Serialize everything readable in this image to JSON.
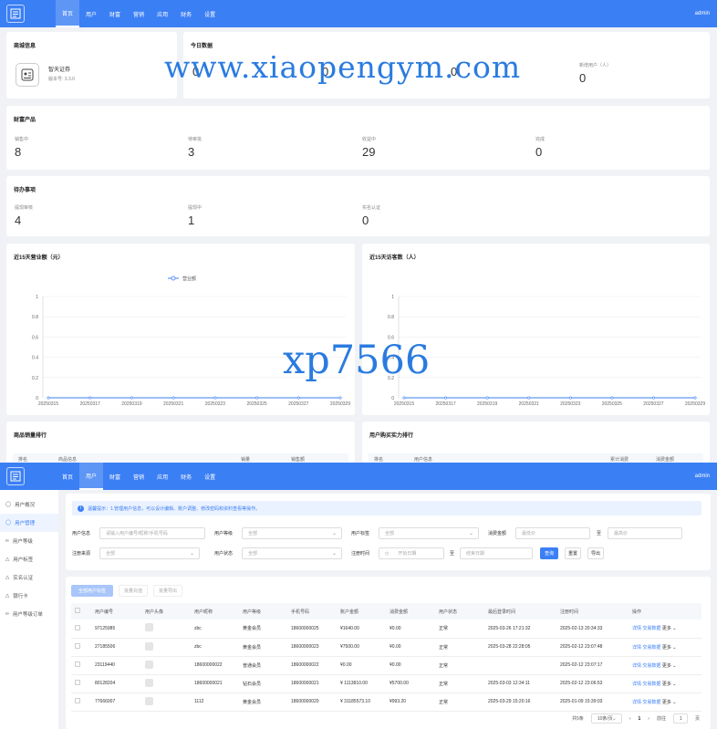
{
  "topnav": {
    "items": [
      "首页",
      "用户",
      "财富",
      "营销",
      "应用",
      "财务",
      "设置"
    ],
    "user": "admin"
  },
  "store_info": {
    "title": "商城信息",
    "name": "智天证券",
    "version": "版本号: 3.3.0"
  },
  "today": {
    "title": "今日数据",
    "stats": [
      {
        "label": "",
        "value": "0"
      },
      {
        "label": "",
        "value": "0"
      },
      {
        "label": "",
        "value": "0"
      },
      {
        "label": "新增用户（人）",
        "value": "0"
      }
    ]
  },
  "wealth": {
    "title": "财富产品",
    "stats": [
      {
        "label": "销售中",
        "value": "8"
      },
      {
        "label": "待审批",
        "value": "3"
      },
      {
        "label": "收益中",
        "value": "29"
      },
      {
        "label": "完成",
        "value": "0"
      }
    ]
  },
  "todo": {
    "title": "待办事项",
    "stats": [
      {
        "label": "提现审核",
        "value": "4"
      },
      {
        "label": "提现中",
        "value": "1"
      },
      {
        "label": "实名认证",
        "value": "0"
      }
    ]
  },
  "chart_data": [
    {
      "type": "line",
      "title": "近15天营业额（元）",
      "legend": "营业额",
      "x": [
        "20250315",
        "20250317",
        "20250319",
        "20250321",
        "20250323",
        "20250325",
        "20250327",
        "20250329"
      ],
      "y": [
        0,
        0,
        0,
        0,
        0,
        0,
        0,
        0
      ],
      "ylim": [
        0,
        1
      ],
      "yticks": [
        "0",
        "0.2",
        "0.4",
        "0.6",
        "0.8",
        "1"
      ]
    },
    {
      "type": "line",
      "title": "近15天访客数（人）",
      "x": [
        "20250315",
        "20250317",
        "20250319",
        "20250321",
        "20250323",
        "20250325",
        "20250327",
        "20250329"
      ],
      "y": [
        0,
        0,
        0,
        0,
        0,
        0,
        0,
        0
      ],
      "ylim": [
        0,
        1
      ],
      "yticks": [
        "0",
        "0.2",
        "0.4",
        "0.6",
        "0.8",
        "1"
      ]
    }
  ],
  "rank1": {
    "title": "商品销量排行",
    "cols": [
      "排名",
      "商品信息",
      "",
      "销量",
      "销售额"
    ]
  },
  "rank2": {
    "title": "用户购买实力排行",
    "cols": [
      "排名",
      "用户信息",
      "",
      "累计消费",
      "消费金额"
    ]
  },
  "watermark": {
    "a": "www.xiaopengym.com",
    "b": "xp7566"
  },
  "sidebar": {
    "items": [
      "用户概况",
      "用户管理",
      "用户等级",
      "用户标签",
      "实名认证",
      "银行卡",
      "用户等级订单"
    ]
  },
  "tip": "温馨提示：1.管理用户信息，可以设计编辑、账户调整、修改密码和资料查看等操作。",
  "filters": {
    "info_label": "用户信息",
    "info_ph": "请输入用户编号/昵称/手机号码",
    "level_label": "用户等级",
    "level_val": "全部",
    "tag_label": "用户标签",
    "tag_val": "全部",
    "amount_label": "消费金额",
    "amount_min": "最低价",
    "to": "至",
    "amount_max": "最高价",
    "source_label": "注册来源",
    "source_val": "全部",
    "status_label": "用户状态",
    "status_val": "全部",
    "time_label": "注册时间",
    "time_start": "开始日期",
    "time_end": "结束日期",
    "search": "查询",
    "reset": "重置",
    "export": "导出"
  },
  "tabs": [
    "全部用户标签",
    "批量充值",
    "批量导出"
  ],
  "table": {
    "cols": [
      "",
      "用户编号",
      "用户头像",
      "用户昵称",
      "用户等级",
      "手机号码",
      "账户金额",
      "消费金额",
      "用户状态",
      "最后登录时间",
      "注册时间",
      "操作"
    ],
    "rows": [
      [
        "97125985",
        "",
        "zbc",
        "黄金会员",
        "18600000025",
        "¥1640.00",
        "¥0.00",
        "正常",
        "2025-03-26 17:21:32",
        "2025-02-13 20:34:33"
      ],
      [
        "27185506",
        "",
        "zbc",
        "黄金会员",
        "18600000023",
        "¥7500.00",
        "¥0.00",
        "正常",
        "2025-03-28 22:28:05",
        "2025-02-12 23:07:48"
      ],
      [
        "23119440",
        "",
        "18600000022",
        "普通会员",
        "18600000022",
        "¥0.00",
        "¥0.00",
        "正常",
        "",
        "2025-02-12 23:07:17"
      ],
      [
        "80128204",
        "",
        "18600000021",
        "钻石会员",
        "18600000021",
        "¥ 1113810.00",
        "¥5700.00",
        "正常",
        "2025-03-03 12:34:11",
        "2025-02-12 23:06:53"
      ],
      [
        "77666007",
        "",
        "1112",
        "黄金会员",
        "18600000020",
        "¥ 31185573.10",
        "¥993.20",
        "正常",
        "2025-03-29 15:20:16",
        "2025-01-09 15:39:03"
      ]
    ],
    "actions": [
      "详情",
      "交易数据",
      "更多"
    ]
  },
  "pagination": {
    "total": "共5条",
    "size": "10条/页",
    "page": "1",
    "goto": "前往",
    "goto_page": "1",
    "unit": "页"
  },
  "colors": {
    "primary": "#3b7ff5"
  }
}
